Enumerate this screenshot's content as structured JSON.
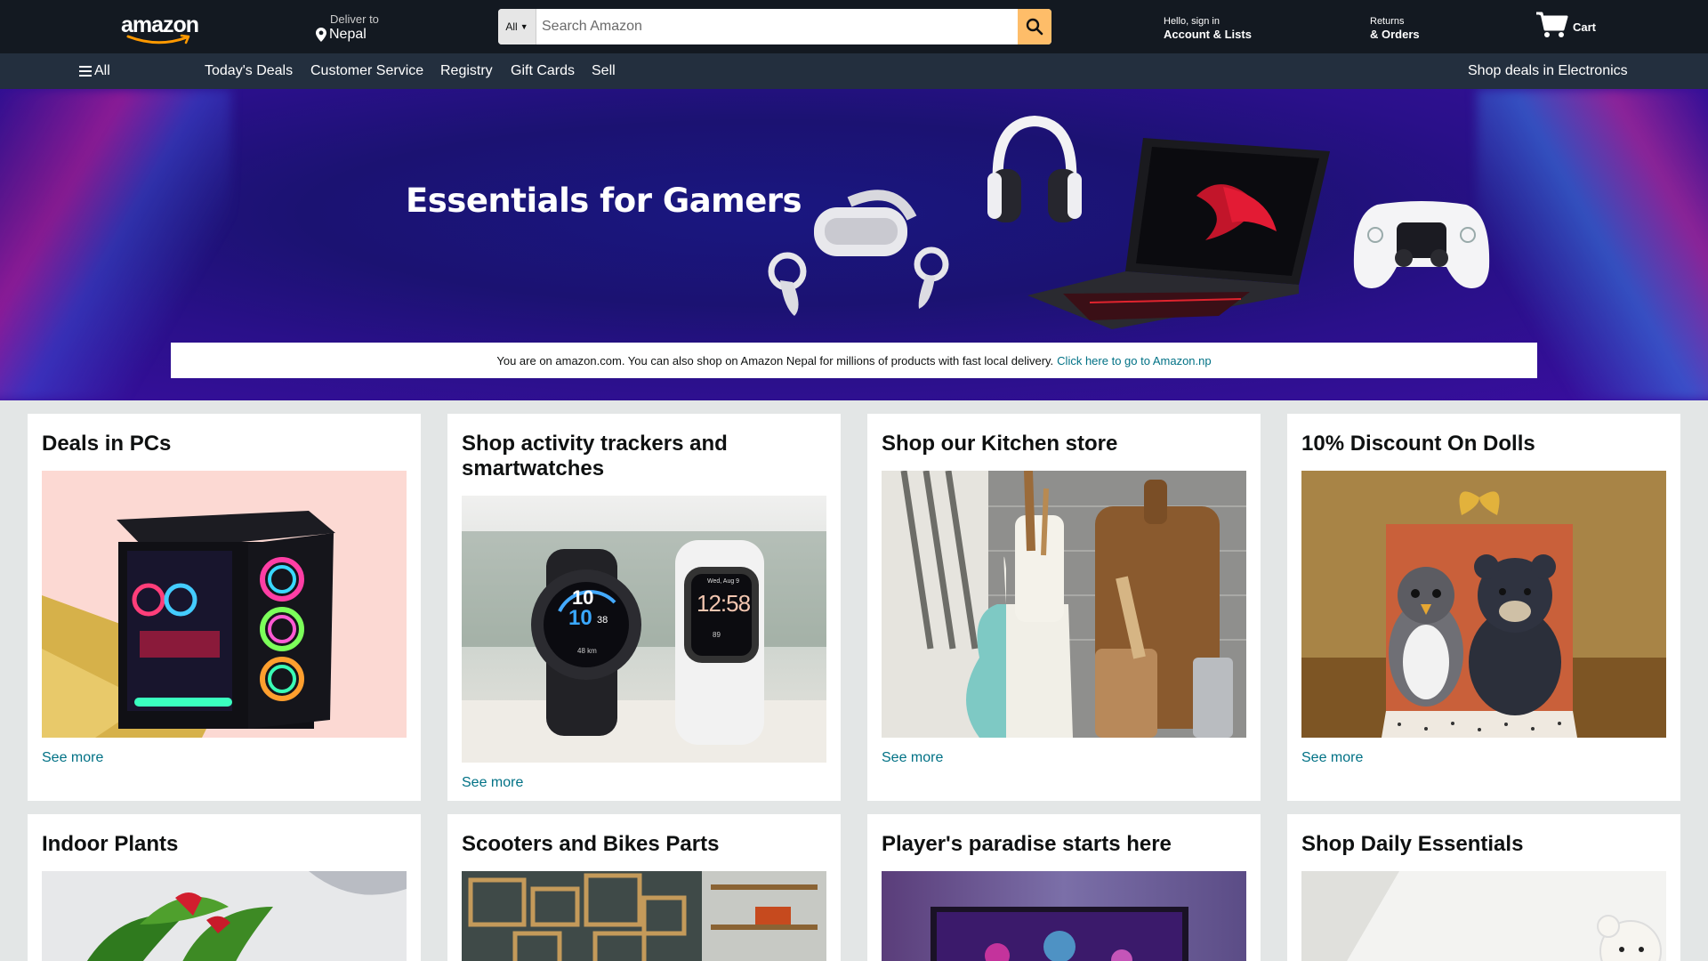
{
  "header": {
    "logo_text": "amazon",
    "deliver_label": "Deliver to",
    "deliver_location": "Nepal",
    "search": {
      "category": "All",
      "placeholder": "Search Amazon"
    },
    "account_greeting": "Hello, sign in",
    "account_label": "Account & Lists",
    "returns_label": "Returns",
    "orders_label": "& Orders",
    "cart_label": "Cart"
  },
  "subnav": {
    "all_label": "All",
    "items": [
      "Today's Deals",
      "Customer Service",
      "Registry",
      "Gift Cards",
      "Sell"
    ],
    "promo": "Shop deals in Electronics"
  },
  "hero": {
    "title": "Essentials for Gamers",
    "notice_text": "You are on amazon.com. You can also shop on Amazon Nepal for millions of products with fast local delivery.",
    "notice_link": "Click here to go to Amazon.np"
  },
  "cards": [
    {
      "title": "Deals in PCs",
      "link": "See more"
    },
    {
      "title": "Shop activity trackers and smartwatches",
      "link": "See more"
    },
    {
      "title": "Shop our Kitchen store",
      "link": "See more"
    },
    {
      "title": "10% Discount On Dolls",
      "link": "See more"
    },
    {
      "title": "Indoor Plants"
    },
    {
      "title": "Scooters and Bikes Parts"
    },
    {
      "title": "Player's paradise starts here"
    },
    {
      "title": "Shop Daily Essentials"
    }
  ],
  "watch_faces": {
    "left_time_h": "10",
    "left_time_m": "10",
    "left_sec": "38",
    "left_dist": "48 km",
    "right_time": "12:58",
    "right_date": "Wed, Aug 9",
    "right_stat": "89"
  },
  "colors": {
    "nav_bg": "#131921",
    "subnav_bg": "#232f3e",
    "search_btn": "#febd69",
    "link": "#007185",
    "page_bg": "#e3e6e6"
  }
}
